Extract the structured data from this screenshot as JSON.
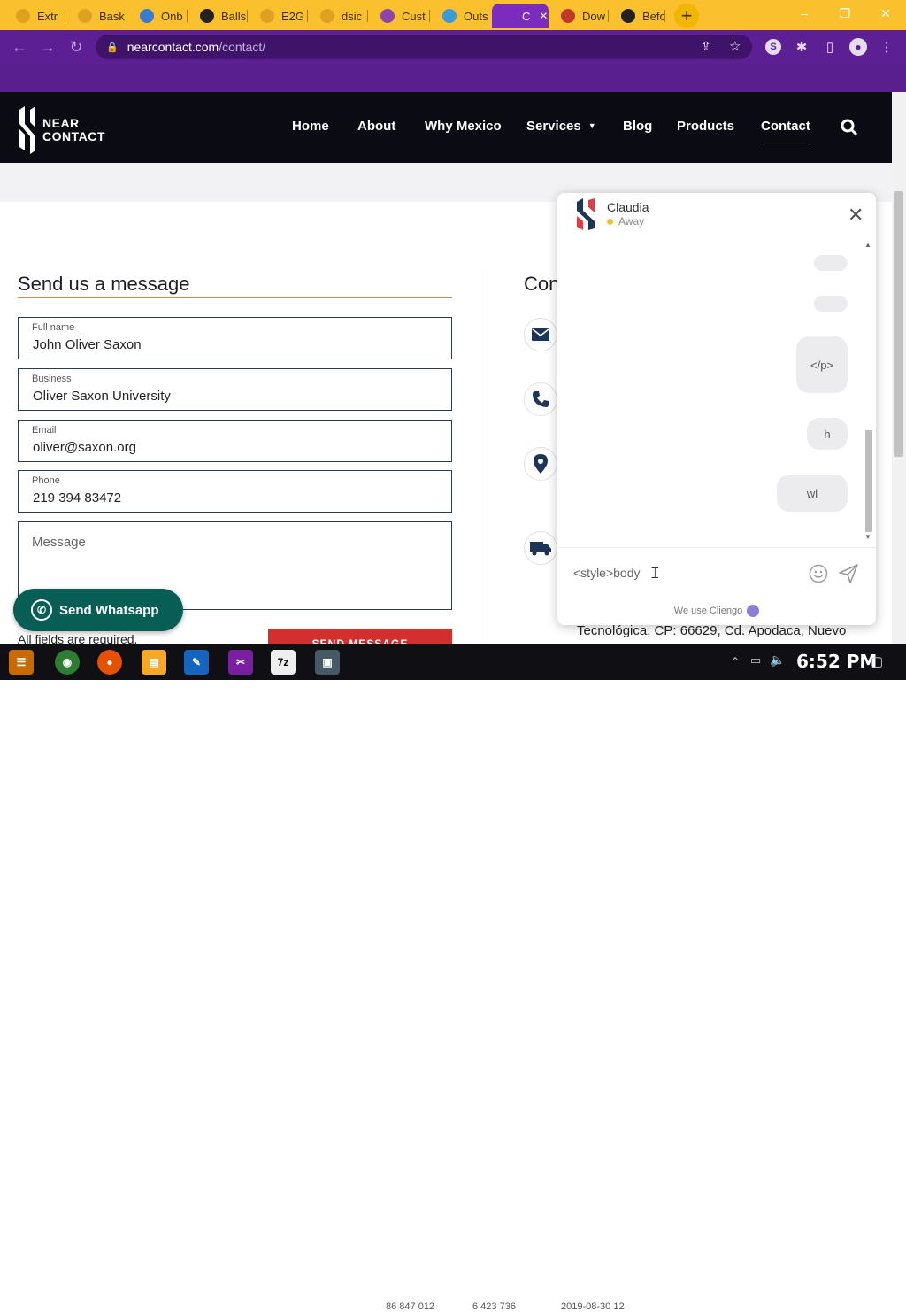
{
  "browser": {
    "tabs": [
      {
        "label": "Extr",
        "color": "#e0a020"
      },
      {
        "label": "Bask",
        "color": "#e0a020"
      },
      {
        "label": "Onb",
        "color": "#3a7bd5"
      },
      {
        "label": "Balls",
        "color": "#222222"
      },
      {
        "label": "E2G",
        "color": "#e0a020"
      },
      {
        "label": "dsic",
        "color": "#e0a020"
      },
      {
        "label": "Cust",
        "color": "#8e44ad"
      },
      {
        "label": "Outs",
        "color": "#3a9ad9"
      },
      {
        "label": "C",
        "color": "#7b2cbf"
      },
      {
        "label": "Dow",
        "color": "#c0392b"
      },
      {
        "label": "Befo",
        "color": "#222222"
      }
    ],
    "new_tab": "+",
    "url_domain": "nearcontact.com",
    "url_path": "/contact/",
    "window_controls": [
      "–",
      "❐",
      "✕"
    ]
  },
  "site": {
    "logo_line1": "NEAR",
    "logo_line2": "CONTACT",
    "nav": [
      "Home",
      "About",
      "Why Mexico",
      "Services",
      "Blog",
      "Products",
      "Contact"
    ],
    "active_nav": "Contact"
  },
  "form": {
    "title": "Send us a message",
    "fields": [
      {
        "label": "Full name",
        "value": "John Oliver Saxon"
      },
      {
        "label": "Business",
        "value": "Oliver Saxon University"
      },
      {
        "label": "Email",
        "value": "oliver@saxon.org"
      },
      {
        "label": "Phone",
        "value": "219 394 83472"
      }
    ],
    "message_placeholder": "Message",
    "required_note": "All fields are required.",
    "send_label": "SEND MESSAGE"
  },
  "contact": {
    "title_partial": "Con",
    "address_partial": "Tecnológica, CP: 66629, Cd. Apodaca, Nuevo"
  },
  "whatsapp": {
    "label": "Send Whatsapp"
  },
  "chat": {
    "agent_name": "Claudia",
    "agent_status": "Away",
    "status_color": "#f2c12e",
    "messages": [
      "",
      "",
      "</p>",
      "h",
      "wl"
    ],
    "input_value": "<style>body",
    "footer": "We use Cliengo"
  },
  "taskbar": {
    "clock": "6:52 PM",
    "ghost_values": [
      "86 847 012",
      "6 423 736",
      "2019-08-30 12"
    ]
  }
}
